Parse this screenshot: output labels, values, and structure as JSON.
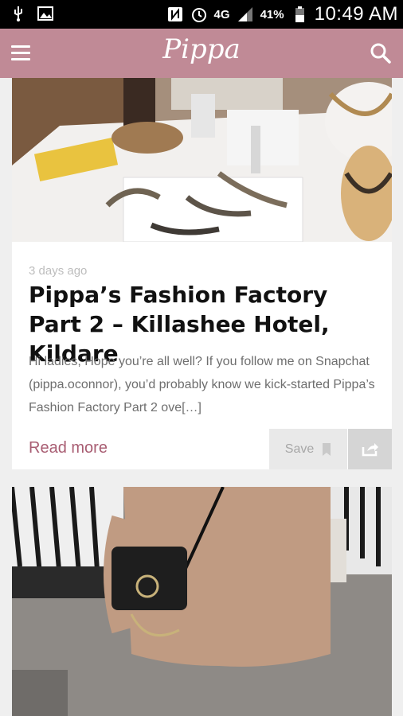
{
  "status_bar": {
    "battery": "41%",
    "time": "10:49 AM",
    "network": "4G"
  },
  "app_bar": {
    "brand": "Pippa"
  },
  "posts": [
    {
      "time_ago": "3 days ago",
      "title": "Pippa’s Fashion Factory Part 2 – Killashee Hotel, Kildare",
      "excerpt": "Hi ladies, Hope you’re all well? If you follow me on Snapchat (pippa.oconnor), you’d probably know we kick-started Pippa’s Fashion Factory Part 2 ove[…]",
      "read_more": "Read more",
      "save_label": "Save"
    }
  ],
  "colors": {
    "accent": "#c08a96",
    "read_more": "#a85d72"
  },
  "icons": [
    "usb-icon",
    "image-icon",
    "nfc-icon",
    "alarm-icon",
    "signal-icon",
    "battery-icon",
    "menu-icon",
    "search-icon",
    "bookmark-icon",
    "share-icon"
  ]
}
